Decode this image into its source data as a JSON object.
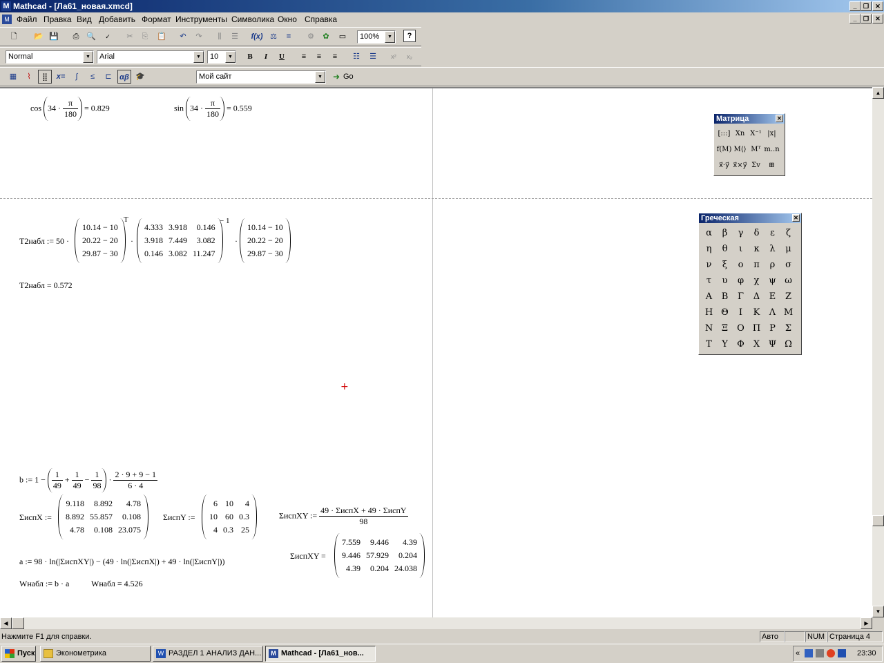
{
  "window": {
    "title": "Mathcad - [Ла61_новая.xmcd]",
    "app_icon": "M"
  },
  "menu": [
    "Файл",
    "Правка",
    "Вид",
    "Добавить",
    "Формат",
    "Инструменты",
    "Символика",
    "Окно",
    "Справка"
  ],
  "toolbar": {
    "zoom": "100%",
    "style": "Normal",
    "font": "Arial",
    "size": "10",
    "bold": "B",
    "italic": "I",
    "underline": "U",
    "url": "Мой сайт",
    "go": "Go"
  },
  "math": {
    "cos_fn": "cos",
    "sin_fn": "sin",
    "deg": "34",
    "pi": "π",
    "den180": "180",
    "cos_res": "= 0.829",
    "sin_res": "= 0.559",
    "t2_lhs": "T2набл := 50 ·",
    "t2_res": "T2набл = 0.572",
    "sup_t": "T",
    "sup_inv": "− 1",
    "dot": "·",
    "vec": [
      "10.14 − 10",
      "20.22 − 20",
      "29.87 − 30"
    ],
    "mat_s": [
      [
        "4.333",
        "3.918",
        "0.146"
      ],
      [
        "3.918",
        "7.449",
        "3.082"
      ],
      [
        "0.146",
        "3.082",
        "11.247"
      ]
    ],
    "b_lhs": "b := 1 −",
    "b_f1n": "1",
    "b_f1d": "49",
    "b_f2d": "49",
    "b_f3d": "98",
    "b_plus": "+",
    "b_minus": "−",
    "b_num": "2 · 9 + 9 − 1",
    "b_den": "6 · 4",
    "sx_lbl": "ΣиспX :=",
    "sx": [
      [
        "9.118",
        "8.892",
        "4.78"
      ],
      [
        "8.892",
        "55.857",
        "0.108"
      ],
      [
        "4.78",
        "0.108",
        "23.075"
      ]
    ],
    "sy_lbl": "ΣиспY :=",
    "sy": [
      [
        "6",
        "10",
        "4"
      ],
      [
        "10",
        "60",
        "0.3"
      ],
      [
        "4",
        "0.3",
        "25"
      ]
    ],
    "sxy_def_lbl": "ΣиспXY :=",
    "sxy_num": "49 · ΣиспX + 49 · ΣиспY",
    "sxy_den": "98",
    "sxy_lbl": "ΣиспXY =",
    "sxy": [
      [
        "7.559",
        "9.446",
        "4.39"
      ],
      [
        "9.446",
        "57.929",
        "0.204"
      ],
      [
        "4.39",
        "0.204",
        "24.038"
      ]
    ],
    "a_expr": "a := 98 · ln(|ΣиспXY|) − (49 · ln(|ΣиспX|) + 49 · ln(|ΣиспY|))",
    "w_def": "Wнабл := b · a",
    "w_res": "Wнабл = 4.526"
  },
  "palettes": {
    "matrix": {
      "title": "Матрица",
      "items": [
        "[:::]",
        "Xn",
        "X⁻¹",
        "|x|",
        "f(M)",
        "M⟨⟩",
        "Mᵀ",
        "m..n",
        "x⃗·y⃗",
        "x⃗×y⃗",
        "Σv",
        "⊞"
      ]
    },
    "greek": {
      "title": "Греческая",
      "items": [
        "α",
        "β",
        "γ",
        "δ",
        "ε",
        "ζ",
        "η",
        "θ",
        "ι",
        "κ",
        "λ",
        "μ",
        "ν",
        "ξ",
        "ο",
        "π",
        "ρ",
        "σ",
        "τ",
        "υ",
        "φ",
        "χ",
        "ψ",
        "ω",
        "Α",
        "Β",
        "Γ",
        "Δ",
        "Ε",
        "Ζ",
        "Η",
        "Θ",
        "Ι",
        "Κ",
        "Λ",
        "Μ",
        "Ν",
        "Ξ",
        "Ο",
        "Π",
        "Ρ",
        "Σ",
        "Τ",
        "Υ",
        "Φ",
        "Χ",
        "Ψ",
        "Ω"
      ]
    }
  },
  "status": {
    "help": "Нажмите F1 для справки.",
    "mode": "Авто",
    "num": "NUM",
    "page": "Страница 4"
  },
  "taskbar": {
    "start": "Пуск",
    "tasks": [
      "Эконометрика",
      "РАЗДЕЛ 1 АНАЛИЗ ДАН...",
      "Mathcad - [Ла61_нов..."
    ],
    "clock": "23:30",
    "chev": "«"
  }
}
